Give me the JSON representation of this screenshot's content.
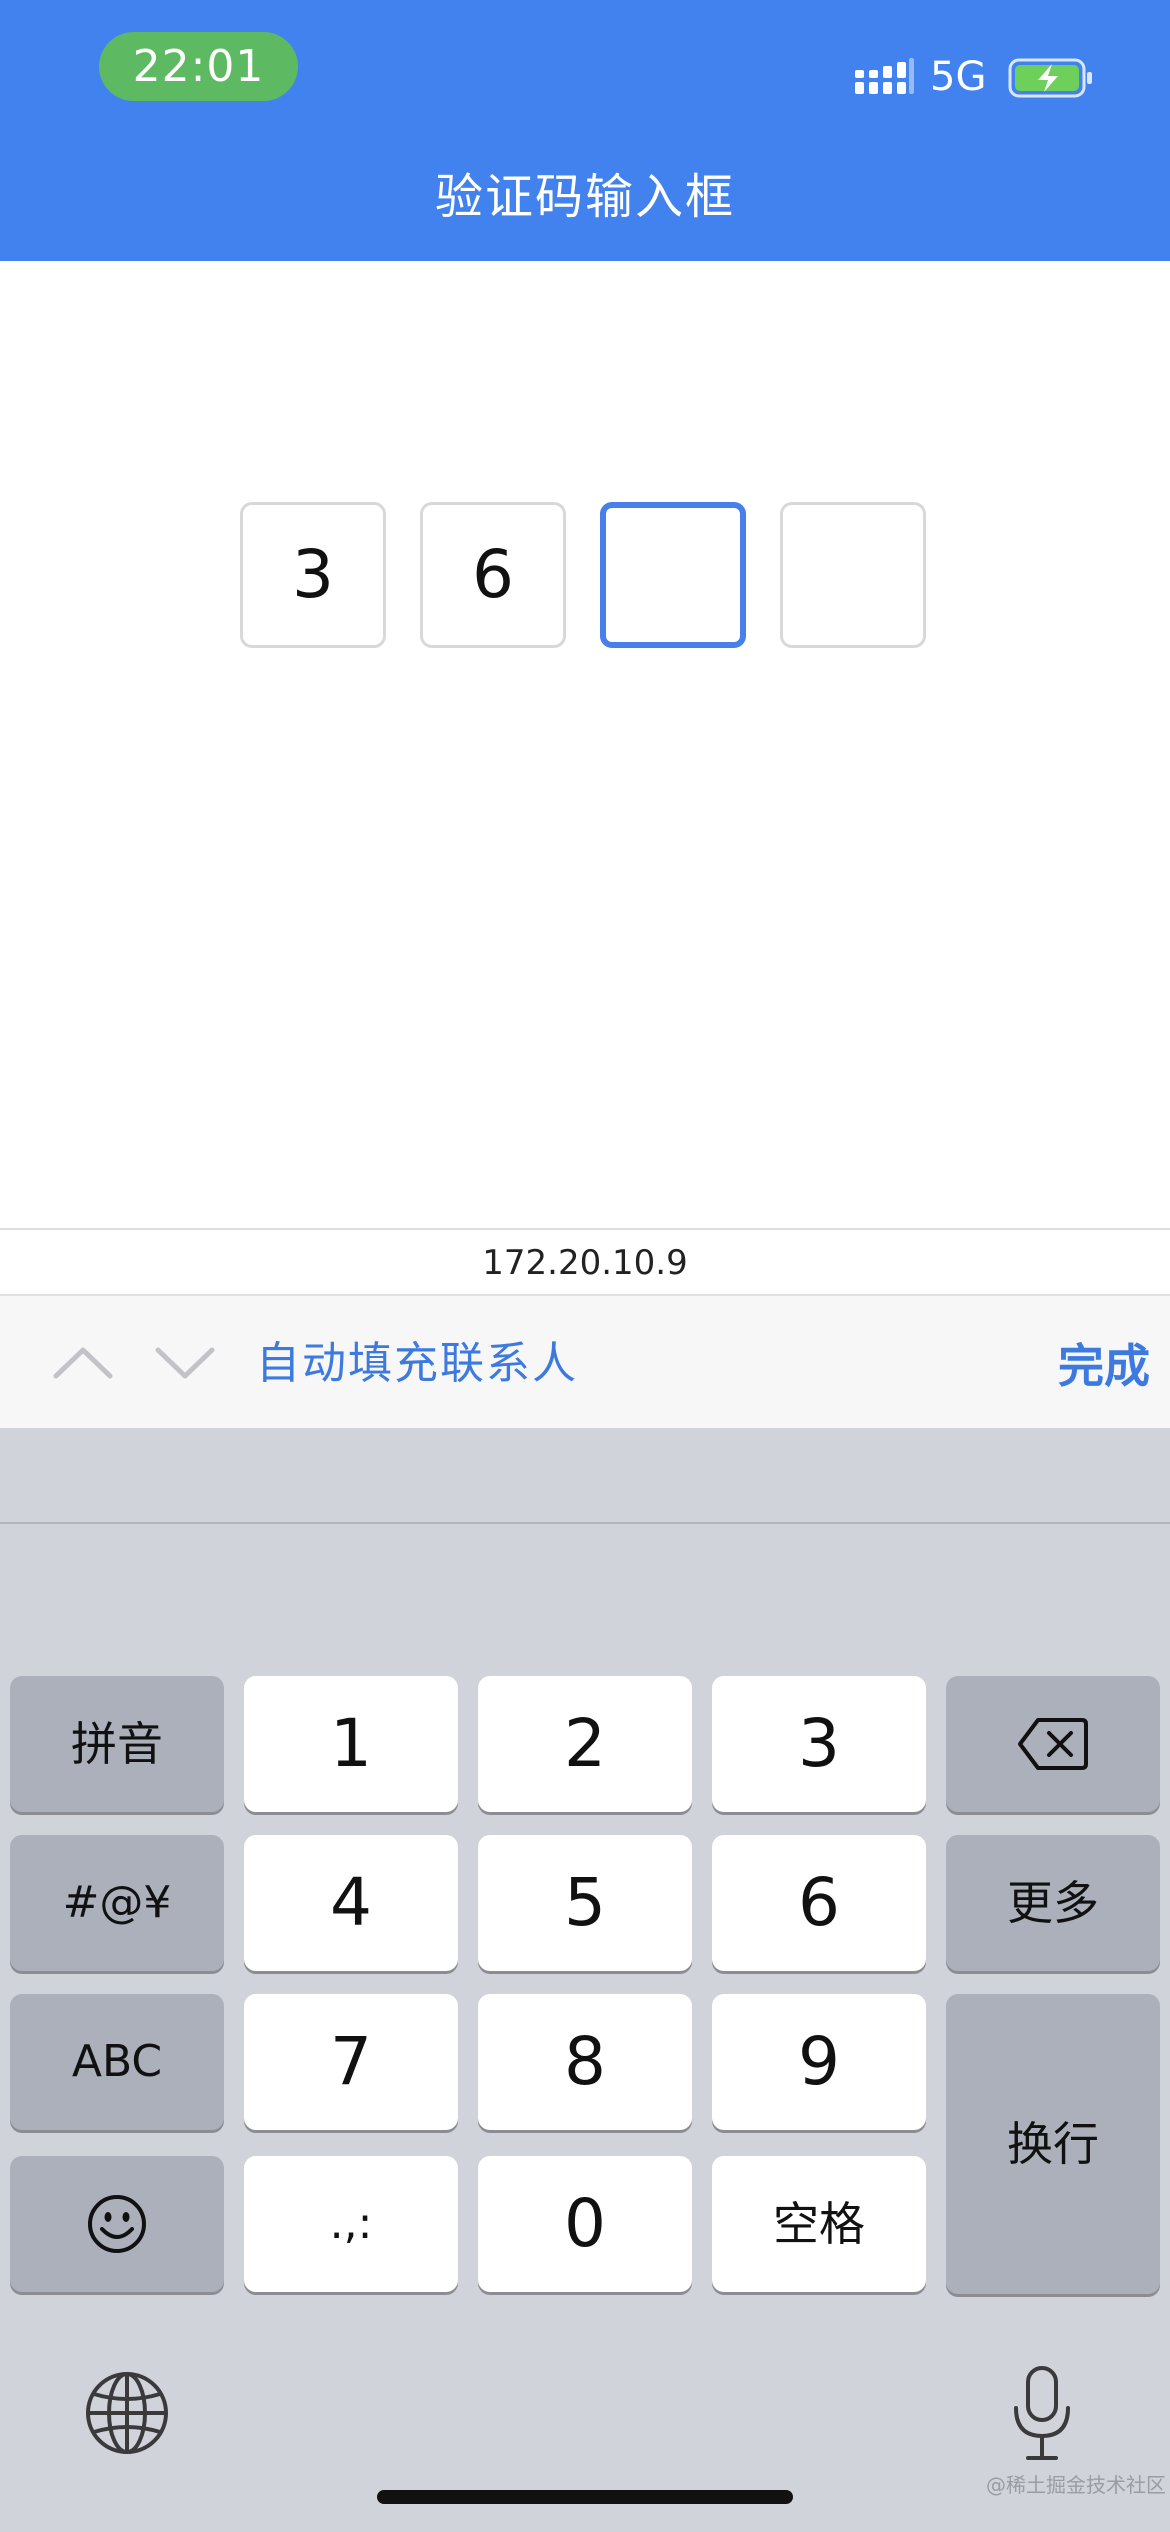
{
  "status_bar": {
    "time": "22:01",
    "network": "5G",
    "battery_state": "charging",
    "colors": {
      "header_bg": "#4282ee",
      "time_pill": "#5dba62",
      "battery_fill": "#6cd05a"
    }
  },
  "header": {
    "title": "验证码输入框"
  },
  "otp": {
    "digits": [
      {
        "value": "3",
        "state": "filled"
      },
      {
        "value": "6",
        "state": "filled"
      },
      {
        "value": "",
        "state": "active"
      },
      {
        "value": "",
        "state": "empty"
      }
    ],
    "active_color": "#4680e8"
  },
  "url_bar": {
    "address": "172.20.10.9"
  },
  "accessory_bar": {
    "prev_icon": "chevron-up-icon",
    "next_icon": "chevron-down-icon",
    "autofill_label": "自动填充联系人",
    "done_label": "完成"
  },
  "keyboard": {
    "rows": [
      [
        "拼音",
        "1",
        "2",
        "3",
        "delete"
      ],
      [
        "#@¥",
        "4",
        "5",
        "6",
        "更多"
      ],
      [
        "ABC",
        "7",
        "8",
        "9",
        "换行"
      ],
      [
        "emoji",
        ".,:",
        "0",
        "空格"
      ]
    ],
    "keys": {
      "pinyin": "拼音",
      "k1": "1",
      "k2": "2",
      "k3": "3",
      "symbols": "#@¥",
      "k4": "4",
      "k5": "5",
      "k6": "6",
      "more": "更多",
      "abc": "ABC",
      "k7": "7",
      "k8": "8",
      "k9": "9",
      "return": "换行",
      "punct": ".,:",
      "k0": "0",
      "space": "空格"
    },
    "icons": [
      "backspace-icon",
      "emoji-icon",
      "globe-icon",
      "microphone-icon"
    ]
  },
  "watermark": "@稀土掘金技术社区"
}
